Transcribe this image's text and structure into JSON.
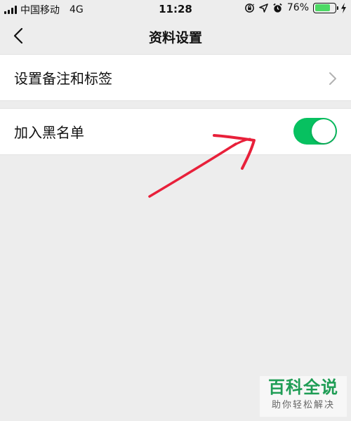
{
  "status_bar": {
    "carrier": "中国移动",
    "network": "4G",
    "time": "11:28",
    "battery_percent": "76%",
    "battery_level": 0.76,
    "icons": [
      "orientation-lock-icon",
      "location-arrow-icon",
      "alarm-clock-icon",
      "battery-icon",
      "charging-bolt-icon"
    ]
  },
  "nav": {
    "back_icon": "chevron-left-icon",
    "title": "资料设置"
  },
  "settings": {
    "remark_tags_label": "设置备注和标签",
    "blacklist_label": "加入黑名单",
    "blacklist_enabled": true
  },
  "colors": {
    "toggle_on": "#07c160",
    "background": "#ededed",
    "annotation_arrow": "#e8203a",
    "watermark_green": "#1f9d55"
  },
  "watermark": {
    "title": "百科全说",
    "subtitle": "助你轻松解决"
  }
}
